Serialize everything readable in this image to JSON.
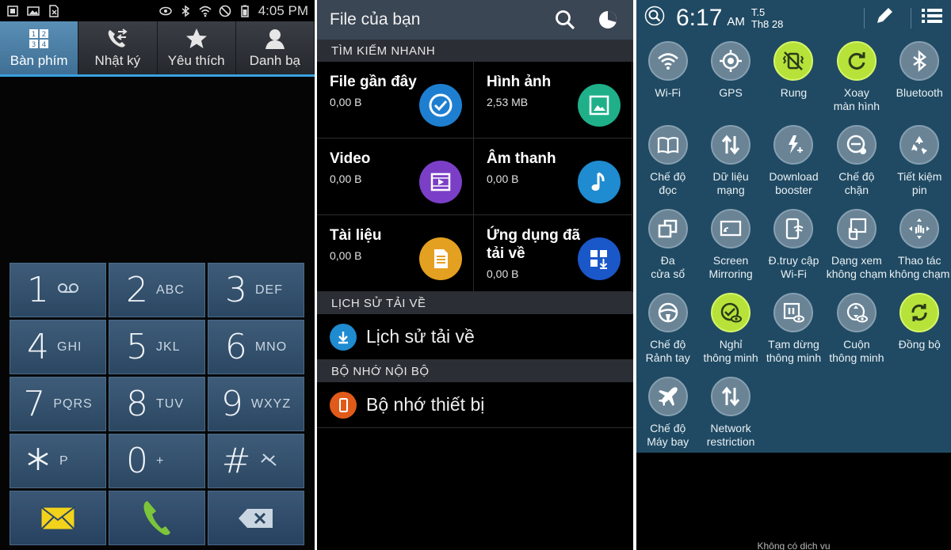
{
  "dialer": {
    "status_time": "4:05 PM",
    "tabs": [
      {
        "label": "Bàn phím",
        "icon": "keypad-icon",
        "active": true
      },
      {
        "label": "Nhật ký",
        "icon": "call-log-icon",
        "active": false
      },
      {
        "label": "Yêu thích",
        "icon": "star-icon",
        "active": false
      },
      {
        "label": "Danh bạ",
        "icon": "contact-icon",
        "active": false
      }
    ],
    "keys": [
      {
        "num": "1",
        "sub": "voicemail"
      },
      {
        "num": "2",
        "sub": "ABC"
      },
      {
        "num": "3",
        "sub": "DEF"
      },
      {
        "num": "4",
        "sub": "GHI"
      },
      {
        "num": "5",
        "sub": "JKL"
      },
      {
        "num": "6",
        "sub": "MNO"
      },
      {
        "num": "7",
        "sub": "PQRS"
      },
      {
        "num": "8",
        "sub": "TUV"
      },
      {
        "num": "9",
        "sub": "WXYZ"
      },
      {
        "num": "*",
        "sub": "P"
      },
      {
        "num": "0",
        "sub": "+"
      },
      {
        "num": "#",
        "sub": "mute"
      }
    ],
    "colors": {
      "accent": "#3aa0e0",
      "call": "#7cc43a",
      "message": "#f2d21b"
    }
  },
  "files": {
    "title": "File của bạn",
    "quick_search_header": "TÌM KIẾM NHANH",
    "categories": [
      {
        "name": "File gần đây",
        "size": "0,00 B",
        "color": "#1e7fd0",
        "icon": "clock-icon"
      },
      {
        "name": "Hình ảnh",
        "size": "2,53 MB",
        "color": "#1fb08a",
        "icon": "image-icon"
      },
      {
        "name": "Video",
        "size": "0,00 B",
        "color": "#7b3fc7",
        "icon": "video-icon"
      },
      {
        "name": "Âm thanh",
        "size": "0,00 B",
        "color": "#1f8bd0",
        "icon": "music-icon"
      },
      {
        "name": "Tài liệu",
        "size": "0,00 B",
        "color": "#e4a020",
        "icon": "document-icon"
      },
      {
        "name": "Ứng dụng đã tải về",
        "size": "0,00 B",
        "color": "#1a57c8",
        "icon": "apps-download-icon"
      }
    ],
    "download_history_header": "LỊCH SỬ TẢI VỀ",
    "download_history_item": "Lịch sử tải về",
    "storage_header": "BỘ NHỚ NỘI BỘ",
    "storage_item": "Bộ nhớ thiết bị"
  },
  "quick_settings": {
    "time": "6:17",
    "ampm": "AM",
    "day": "T.5",
    "date": "Th8 28",
    "tiles": [
      {
        "label": "Wi-Fi",
        "icon": "wifi-icon",
        "on": false
      },
      {
        "label": "GPS",
        "icon": "gps-icon",
        "on": false
      },
      {
        "label": "Rung",
        "icon": "vibrate-icon",
        "on": true
      },
      {
        "label": "Xoay\nmàn hình",
        "icon": "rotate-icon",
        "on": true
      },
      {
        "label": "Bluetooth",
        "icon": "bluetooth-icon",
        "on": false
      },
      {
        "label": "Chế độ\nđọc",
        "icon": "reading-icon",
        "on": false
      },
      {
        "label": "Dữ liệu\nmạng",
        "icon": "mobile-data-icon",
        "on": false
      },
      {
        "label": "Download\nbooster",
        "icon": "download-booster-icon",
        "on": false
      },
      {
        "label": "Chế độ\nchặn",
        "icon": "block-icon",
        "on": false
      },
      {
        "label": "Tiết kiệm\npin",
        "icon": "power-saving-icon",
        "on": false
      },
      {
        "label": "Đa\ncửa sổ",
        "icon": "multi-window-icon",
        "on": false
      },
      {
        "label": "Screen\nMirroring",
        "icon": "screen-mirroring-icon",
        "on": false
      },
      {
        "label": "Đ.truy cập\nWi-Fi",
        "icon": "hotspot-icon",
        "on": false
      },
      {
        "label": "Dạng xem\nkhông chạm",
        "icon": "air-view-icon",
        "on": false
      },
      {
        "label": "Thao tác\nkhông chạm",
        "icon": "air-gesture-icon",
        "on": false
      },
      {
        "label": "Chế độ\nRảnh tay",
        "icon": "driving-icon",
        "on": false
      },
      {
        "label": "Nghỉ\nthông minh",
        "icon": "smart-stay-icon",
        "on": true
      },
      {
        "label": "Tạm dừng\nthông minh",
        "icon": "smart-pause-icon",
        "on": false
      },
      {
        "label": "Cuộn\nthông minh",
        "icon": "smart-scroll-icon",
        "on": false
      },
      {
        "label": "Đồng bộ",
        "icon": "sync-icon",
        "on": true
      },
      {
        "label": "Chế độ\nMáy bay",
        "icon": "airplane-icon",
        "on": false
      },
      {
        "label": "Network\nrestriction",
        "icon": "network-restriction-icon",
        "on": false
      }
    ],
    "no_service": "Không có dịch vụ",
    "colors": {
      "panel": "#204a63",
      "tile_on": "#b6e23a",
      "tile_off": "#6a8496"
    }
  }
}
